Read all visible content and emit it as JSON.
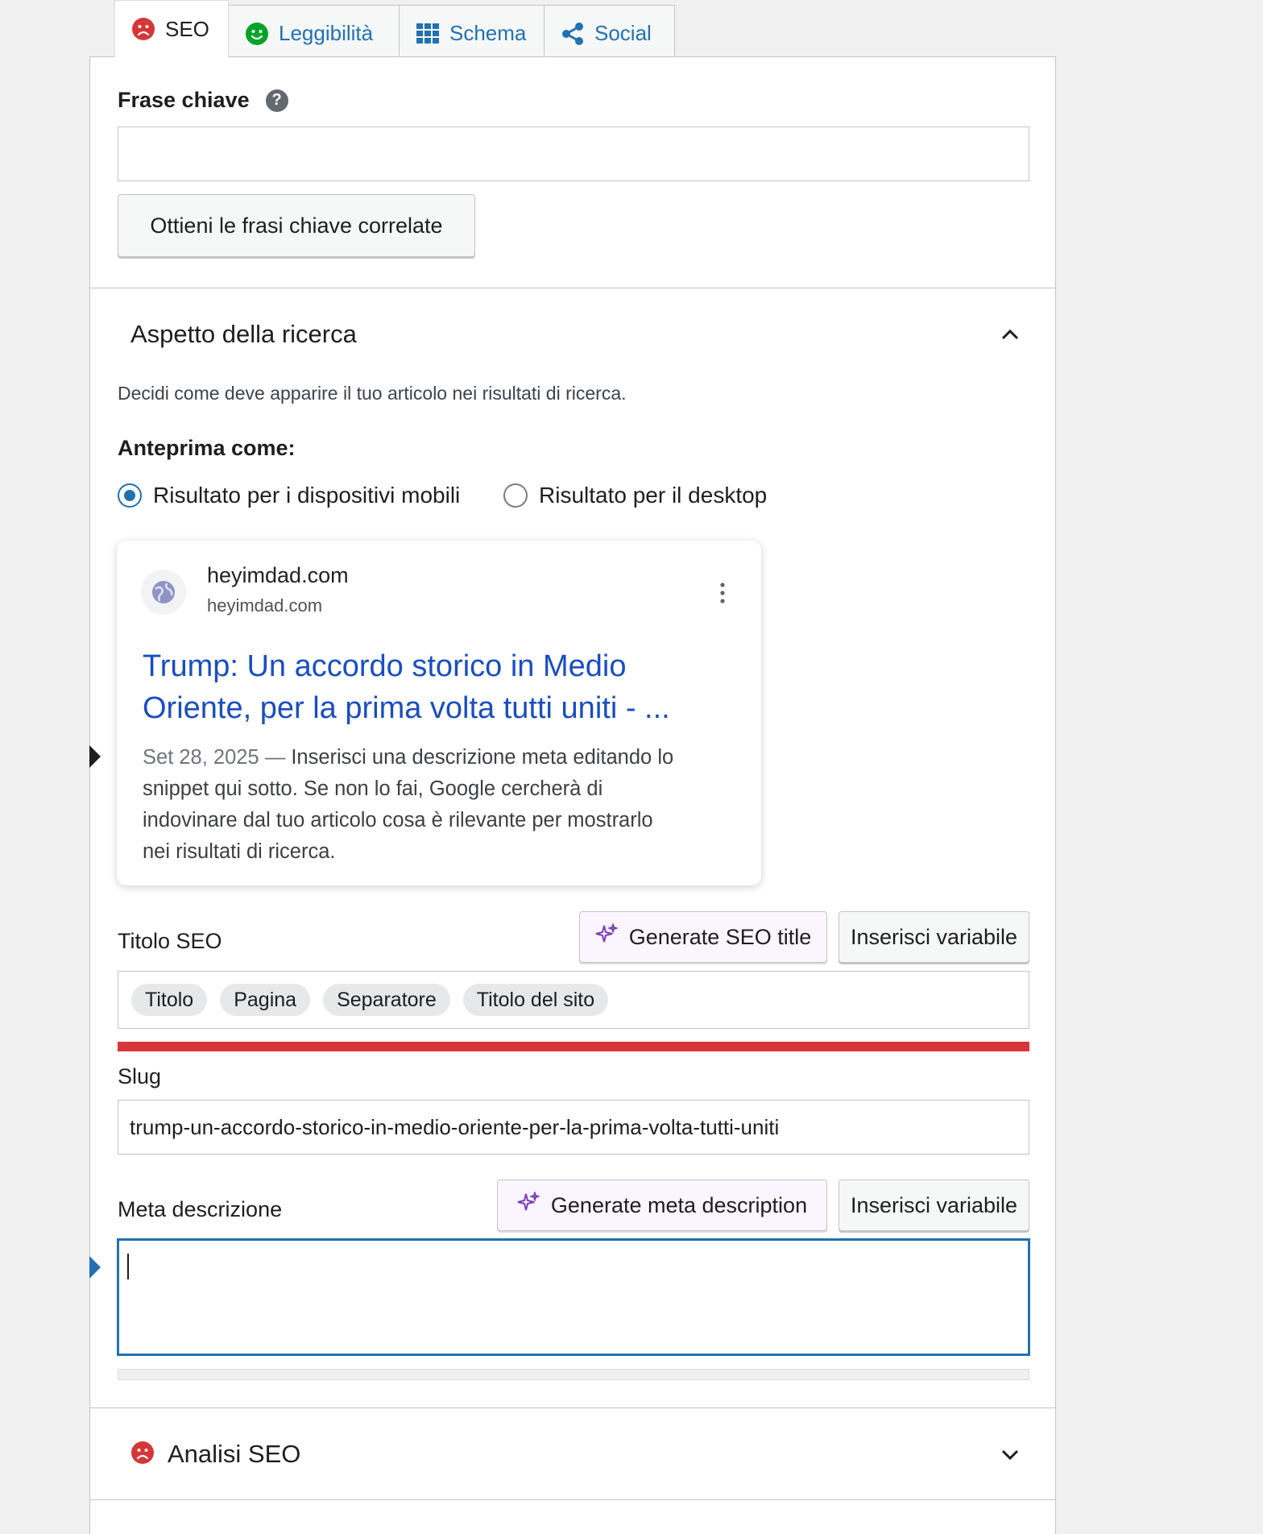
{
  "tabs": [
    {
      "label": "SEO",
      "icon": "sad-face-icon"
    },
    {
      "label": "Leggibilità",
      "icon": "smile-face-icon"
    },
    {
      "label": "Schema",
      "icon": "grid-icon"
    },
    {
      "label": "Social",
      "icon": "share-icon"
    }
  ],
  "keyphrase": {
    "label": "Frase chiave",
    "value": "",
    "related_button": "Ottieni le frasi chiave correlate"
  },
  "search_appearance": {
    "title": "Aspetto della ricerca",
    "description": "Decidi come deve apparire il tuo articolo nei risultati di ricerca.",
    "preview_label": "Anteprima come:",
    "radio_mobile": "Risultato per i dispositivi mobili",
    "radio_desktop": "Risultato per il desktop",
    "selected": "mobile"
  },
  "snippet": {
    "site_name": "heyimdad.com",
    "site_url": "heyimdad.com",
    "title_line1": "Trump: Un accordo storico in Medio",
    "title_line2": "Oriente, per la prima volta tutti uniti - ...",
    "date": "Set 28, 2025",
    "dash": "—",
    "desc_line1": "Inserisci una descrizione meta editando lo",
    "desc_line2": "snippet qui sotto. Se non lo fai, Google cercherà di",
    "desc_line3": "indovinare dal tuo articolo cosa è rilevante per mostrarlo",
    "desc_line4": "nei risultati di ricerca."
  },
  "seo_title": {
    "label": "Titolo SEO",
    "generate_button": "Generate SEO title",
    "insert_variable": "Inserisci variabile",
    "pills": [
      "Titolo",
      "Pagina",
      "Separatore",
      "Titolo del sito"
    ],
    "progress_color": "#d63638",
    "progress": 1.0
  },
  "slug": {
    "label": "Slug",
    "value": "trump-un-accordo-storico-in-medio-oriente-per-la-prima-volta-tutti-uniti"
  },
  "meta_description": {
    "label": "Meta descrizione",
    "generate_button": "Generate meta description",
    "insert_variable": "Inserisci variabile",
    "value": "",
    "progress": 0
  },
  "analysis": {
    "title": "Analisi SEO",
    "status": "sad-face-icon"
  },
  "colors": {
    "accent": "#2271b1",
    "error": "#d63638",
    "good": "#00a32a",
    "link": "#1a0dab"
  }
}
